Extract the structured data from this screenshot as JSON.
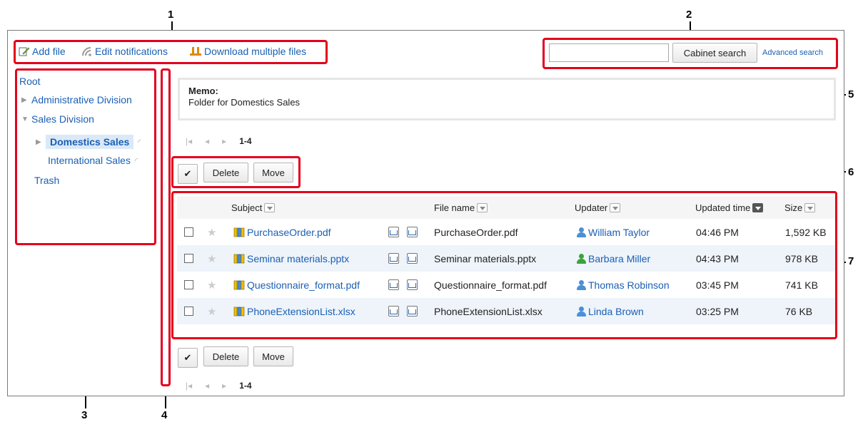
{
  "callouts": [
    "1",
    "2",
    "3",
    "4",
    "5",
    "6",
    "7"
  ],
  "toolbar": {
    "add_file": "Add file",
    "edit_notifications": "Edit notifications",
    "download_multiple": "Download multiple files"
  },
  "search": {
    "value": "",
    "button": "Cabinet search",
    "advanced": "Advanced search"
  },
  "tree": {
    "root": "Root",
    "admin": "Administrative Division",
    "sales": "Sales Division",
    "domestic": "Domestics Sales",
    "international": "International Sales",
    "trash": "Trash"
  },
  "memo": {
    "label": "Memo:",
    "text": "Folder for Domestics Sales"
  },
  "pager": {
    "count": "1-4"
  },
  "actions": {
    "check_all": "✔",
    "delete": "Delete",
    "move": "Move"
  },
  "table": {
    "headers": {
      "subject": "Subject",
      "file_name": "File name",
      "updater": "Updater",
      "updated_time": "Updated time",
      "size": "Size"
    },
    "rows": [
      {
        "subject": "PurchaseOrder.pdf",
        "file_name": "PurchaseOrder.pdf",
        "updater": "William Taylor",
        "time": "04:46 PM",
        "size": "1,592 KB",
        "user_color": "#4a90d9"
      },
      {
        "subject": "Seminar materials.pptx",
        "file_name": "Seminar materials.pptx",
        "updater": "Barbara Miller",
        "time": "04:43 PM",
        "size": "978 KB",
        "user_color": "#3aa33a"
      },
      {
        "subject": "Questionnaire_format.pdf",
        "file_name": "Questionnaire_format.pdf",
        "updater": "Thomas Robinson",
        "time": "03:45 PM",
        "size": "741 KB",
        "user_color": "#4a90d9"
      },
      {
        "subject": "PhoneExtensionList.xlsx",
        "file_name": "PhoneExtensionList.xlsx",
        "updater": "Linda Brown",
        "time": "03:25 PM",
        "size": "76 KB",
        "user_color": "#4a90d9"
      }
    ]
  },
  "colors": {
    "callout_red": "#e3001b",
    "link_blue": "#1a5fb4",
    "row_alt": "#eef4fa"
  }
}
